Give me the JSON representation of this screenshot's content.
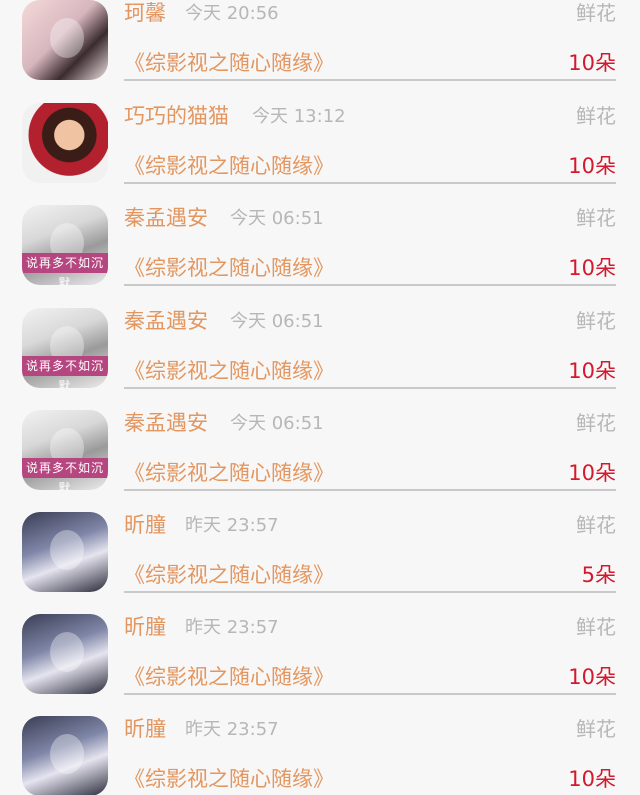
{
  "items": [
    {
      "name": "珂馨",
      "time": "今天 20:56",
      "type": "鲜花",
      "book": "《综影视之随心随缘》",
      "count": "10朵",
      "avatar": "woman-sketch-avatar"
    },
    {
      "name": "巧巧的猫猫",
      "time": "今天 13:12",
      "type": "鲜花",
      "book": "《综影视之随心随缘》",
      "count": "10朵",
      "avatar": "woman-hat-avatar"
    },
    {
      "name": "秦孟遇安",
      "time": "今天 06:51",
      "type": "鲜花",
      "book": "《综影视之随心随缘》",
      "count": "10朵",
      "avatar": "grayscale-portrait-avatar",
      "avatar_text": "说再多不如沉默"
    },
    {
      "name": "秦孟遇安",
      "time": "今天 06:51",
      "type": "鲜花",
      "book": "《综影视之随心随缘》",
      "count": "10朵",
      "avatar": "grayscale-portrait-avatar",
      "avatar_text": "说再多不如沉默"
    },
    {
      "name": "秦孟遇安",
      "time": "今天 06:51",
      "type": "鲜花",
      "book": "《综影视之随心随缘》",
      "count": "10朵",
      "avatar": "grayscale-portrait-avatar",
      "avatar_text": "说再多不如沉默"
    },
    {
      "name": "昕朣",
      "time": "昨天 23:57",
      "type": "鲜花",
      "book": "《综影视之随心随缘》",
      "count": "5朵",
      "avatar": "anime-girl-avatar"
    },
    {
      "name": "昕朣",
      "time": "昨天 23:57",
      "type": "鲜花",
      "book": "《综影视之随心随缘》",
      "count": "10朵",
      "avatar": "anime-girl-avatar"
    },
    {
      "name": "昕朣",
      "time": "昨天 23:57",
      "type": "鲜花",
      "book": "《综影视之随心随缘》",
      "count": "10朵",
      "avatar": "anime-girl-avatar"
    }
  ],
  "colors": {
    "name": "#e3965f",
    "book": "#e3965f",
    "count": "#d4182d",
    "muted": "#b7b7b7",
    "background": "#f7f7f7",
    "separator": "#c9c9c9"
  }
}
